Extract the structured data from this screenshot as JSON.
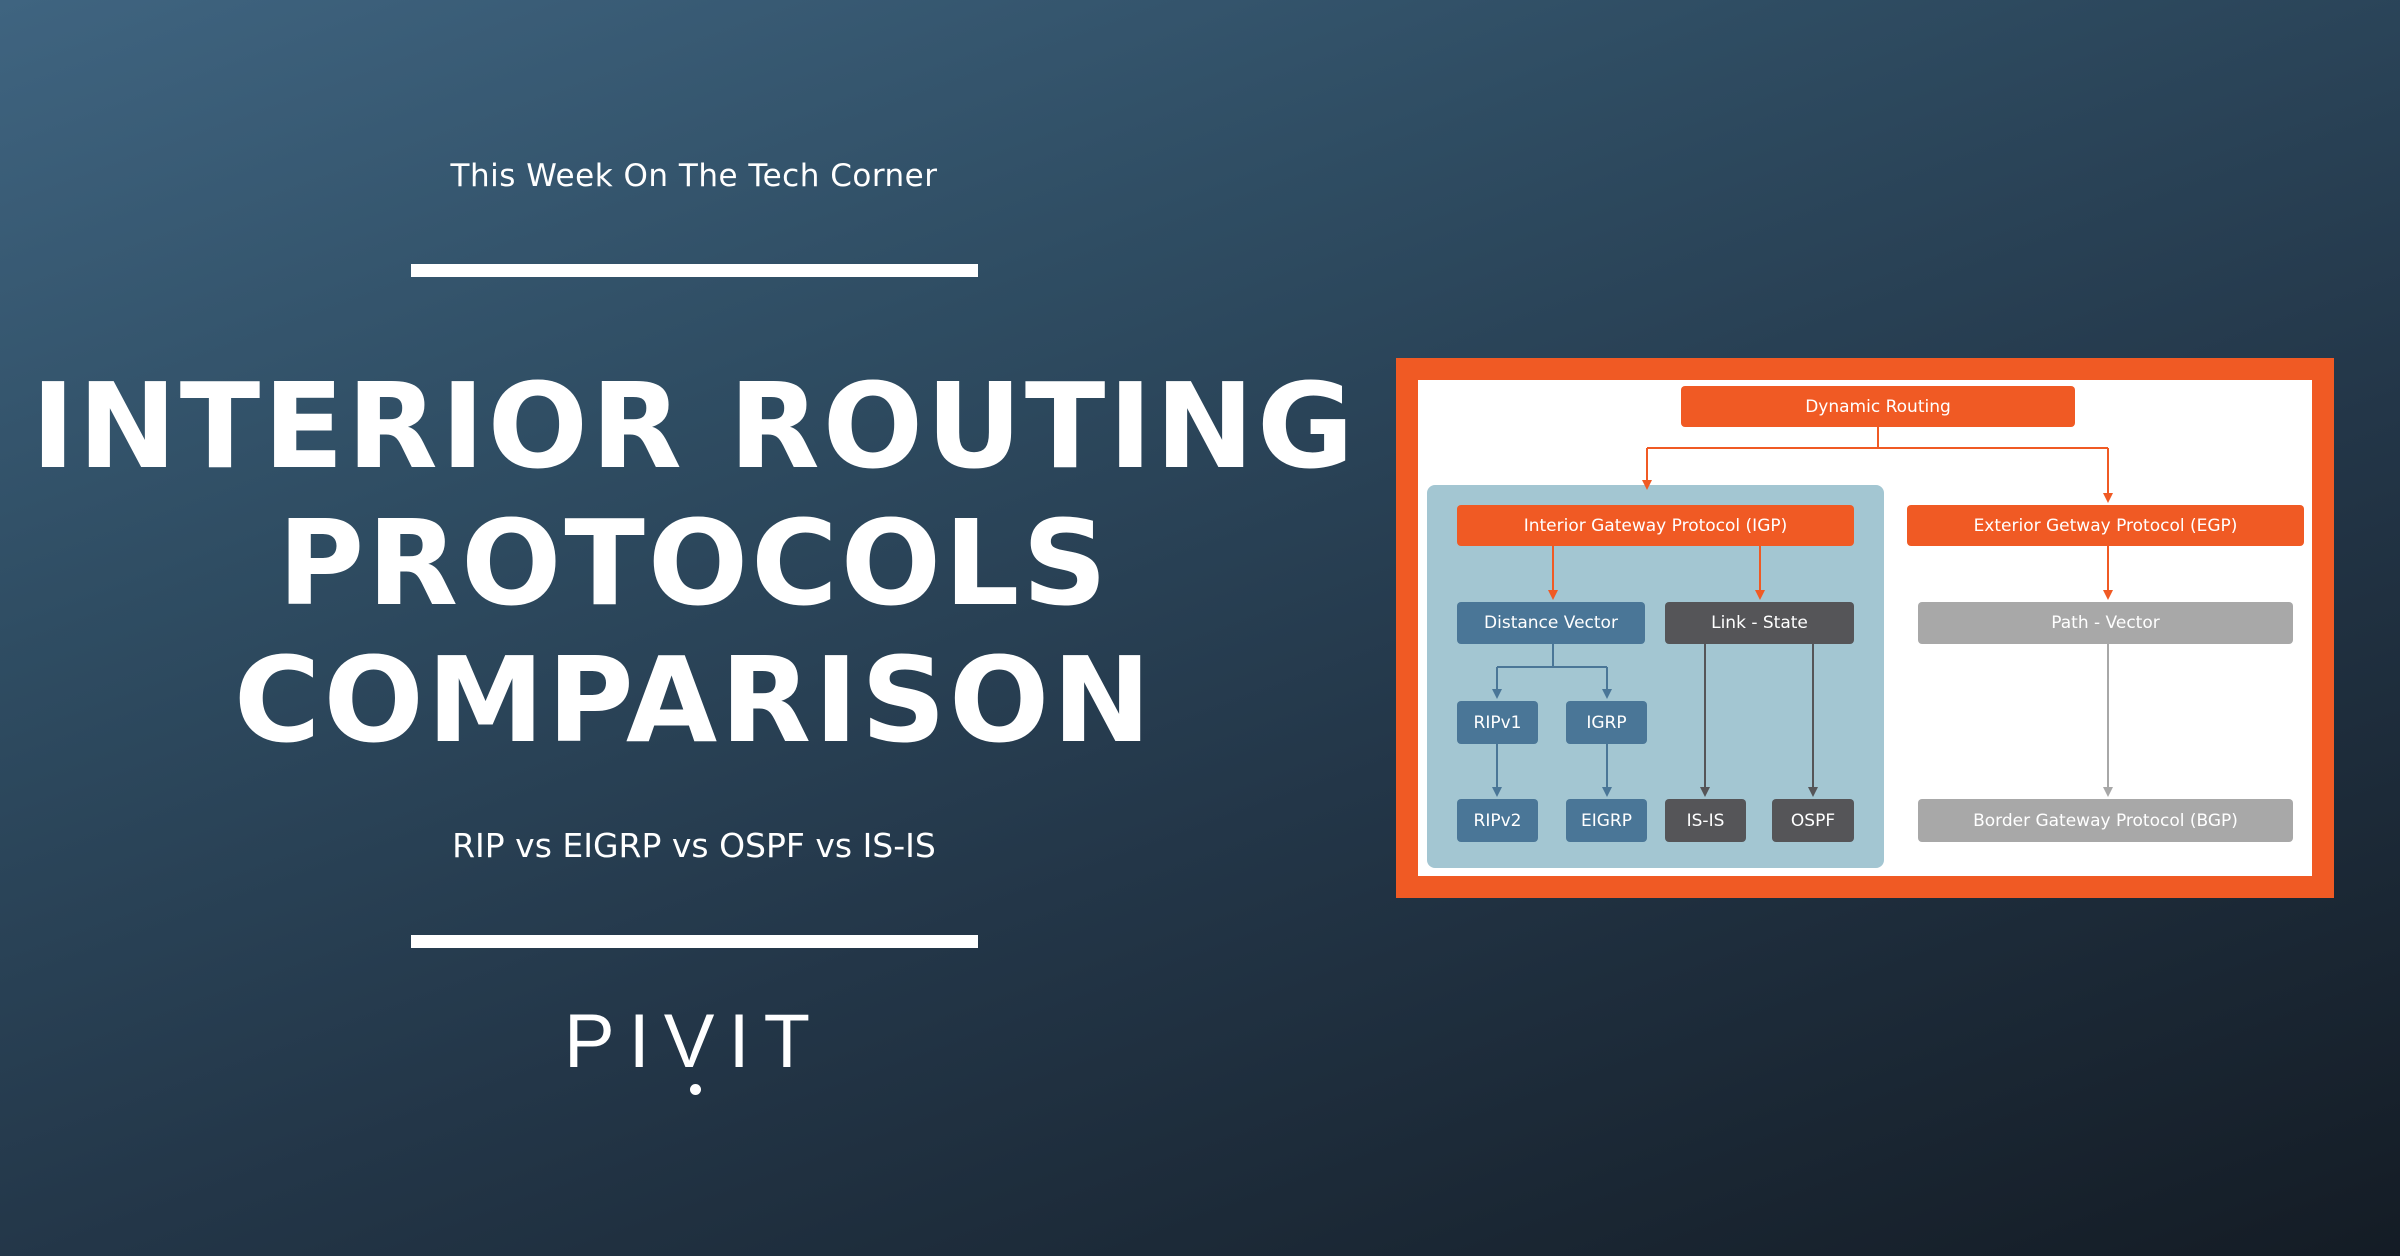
{
  "header": {
    "kicker": "This Week On The Tech Corner",
    "title_lines": [
      "INTERIOR ROUTING",
      "PROTOCOLS",
      "COMPARISON"
    ],
    "subtitle": "RIP vs EIGRP vs OSPF vs IS-IS"
  },
  "brand": {
    "logo_text": "PIVIT"
  },
  "colors": {
    "accent_orange": "#f05a24",
    "distance_vector_blue": "#4a7697",
    "link_state_dark": "#555558",
    "path_vector_gray": "#a8a8a8",
    "igp_panel": "#a3c6d2"
  },
  "diagram": {
    "root": "Dynamic Routing",
    "igp": {
      "label": "Interior Gateway Protocol (IGP)",
      "distance_vector": {
        "label": "Distance Vector",
        "protocols": [
          {
            "label": "RIPv1",
            "successor": "RIPv2"
          },
          {
            "label": "IGRP",
            "successor": "EIGRP"
          }
        ]
      },
      "link_state": {
        "label": "Link - State",
        "protocols": [
          "IS-IS",
          "OSPF"
        ]
      }
    },
    "egp": {
      "label": "Exterior Getway Protocol (EGP)",
      "path_vector": {
        "label": "Path - Vector",
        "protocols": [
          "Border Gateway Protocol (BGP)"
        ]
      }
    }
  }
}
